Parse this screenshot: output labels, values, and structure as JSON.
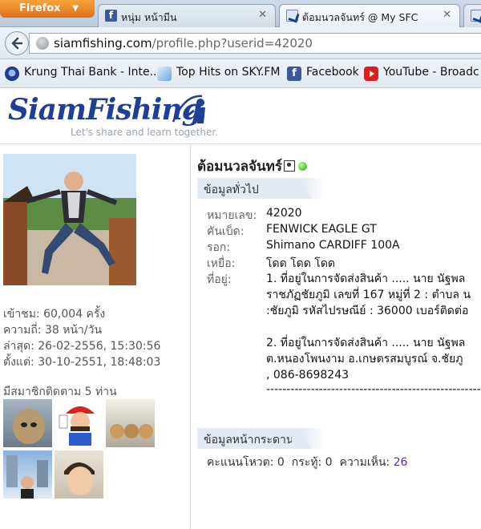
{
  "browser": {
    "app_button": "Firefox",
    "tabs": [
      {
        "label": "หนุ่ม หน้ามีน",
        "active": false
      },
      {
        "label": "ต้อมนวลจันทร์ @ My SFC",
        "active": true
      }
    ],
    "url": {
      "domain": "siamfishing.com",
      "path": "/profile.php?userid=42020"
    },
    "bookmarks": [
      {
        "label": "Krung Thai Bank - Inte..."
      },
      {
        "label": "Top Hits on SKY.FM"
      },
      {
        "label": "Facebook"
      },
      {
        "label": "YouTube - Broadc"
      }
    ]
  },
  "site": {
    "logo": "SiamFishing",
    "tagline": "Let's share and learn together."
  },
  "profile": {
    "name": "ต้อมนวลจันทร์",
    "stats": [
      "เข้าชม: 60,004 ครั้ง",
      "ความถี่: 38 หน้า/วัน",
      "ล่าสุด: 26-02-2556, 15:30:56",
      "ตั้งแต่: 30-10-2551, 18:48:03"
    ],
    "followers_title": "มีสมาชิกติดตาม 5 ท่าน",
    "general_section": "ข้อมูลทั่วไป",
    "fields": [
      {
        "label": "หมายเลข:",
        "value": "42020"
      },
      {
        "label": "คันเบ็ด:",
        "value": "FENWICK EAGLE GT"
      },
      {
        "label": "รอก:",
        "value": "Shimano CARDIFF 100A"
      },
      {
        "label": "เหยื่อ:",
        "value": "โดด โดด โดด"
      },
      {
        "label": "ที่อยู่:",
        "value": ""
      }
    ],
    "address_lines": [
      "1. ที่อยู่ในการจัดส่งสินค้า ..... นาย นัฐพล",
      "ราชภัฏชัยภูมิ เลขที่ 167 หมู่ที่ 2 : ตำบล น",
      ":ชัยภูมิ รหัสไปรษณีย์ : 36000 เบอร์ติดต่อ",
      "",
      "2. ที่อยู่ในการจัดส่งสินค้า ..... นาย นัฐพล",
      "ต.หนองโพนงาม อ.เกษตรสมบูรณ์ จ.ชัยภู",
      ", 086-8698243"
    ],
    "dash_line": "-------------------------------------------------------------------",
    "board_section": "ข้อมูลหน้ากระดาน",
    "board": {
      "votes_label": "คะแนนโหวต:",
      "votes": "0",
      "threads_label": "กระทู้:",
      "threads": "0",
      "comments_label": "ความเห็น:",
      "comments": "26"
    }
  }
}
